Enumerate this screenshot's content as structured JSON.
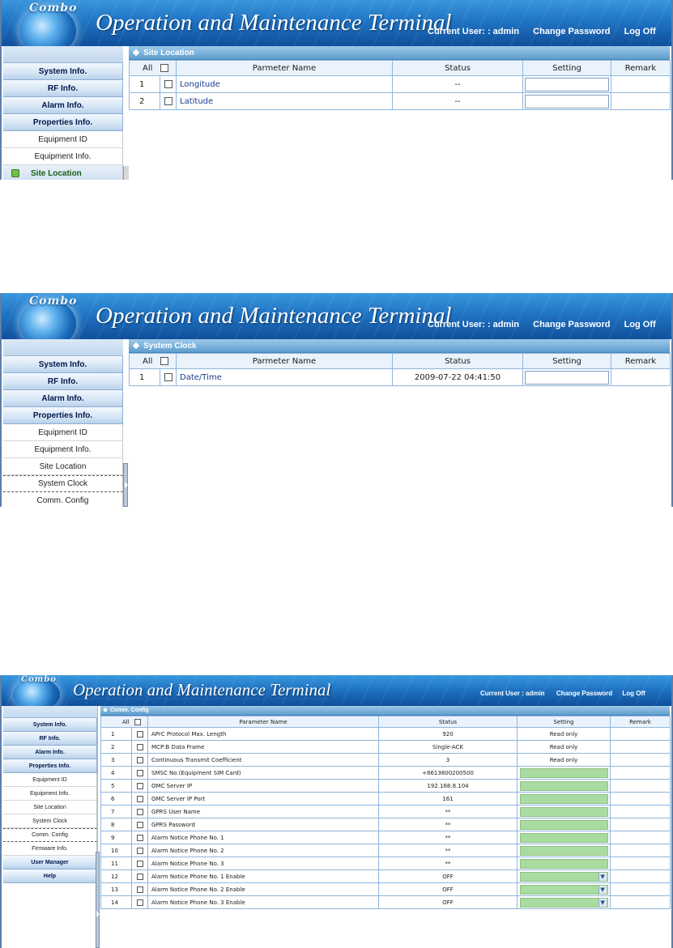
{
  "app": {
    "logo_text": "Combo",
    "title": "Operation and Maintenance Terminal",
    "user_label_top": "Current User: : admin",
    "user_label_bottom": "Current User : admin",
    "change_password": "Change Password",
    "log_off": "Log Off"
  },
  "sidebar": {
    "main": {
      "system": "System Info.",
      "rf": "RF Info.",
      "alarm": "Alarm Info.",
      "properties": "Properties Info.",
      "user_manager": "User Manager",
      "help": "Help"
    },
    "sub": {
      "equipment_id": "Equipment ID",
      "equipment_info": "Equipment Info.",
      "site_location": "Site Location",
      "system_clock": "System Clock",
      "comm_config": "Comm. Config",
      "firmware_info": "Firmware Info."
    }
  },
  "columns": {
    "all": "All",
    "name": "Parmeter Name",
    "name_alt": "Parameter Name",
    "status": "Status",
    "setting": "Setting",
    "remark": "Remark"
  },
  "panel1": {
    "section": "Site Location",
    "rows": [
      {
        "n": "1",
        "name": "Longitude",
        "status": "--"
      },
      {
        "n": "2",
        "name": "Latitude",
        "status": "--"
      }
    ]
  },
  "panel2": {
    "section": "System Clock",
    "rows": [
      {
        "n": "1",
        "name": "Date/Time",
        "status": "2009-07-22 04:41:50"
      }
    ]
  },
  "panel3": {
    "section": "Comm. Config",
    "rows": [
      {
        "n": "1",
        "name": "APrC Protocol Max. Length",
        "status": "920",
        "setting": "Read only"
      },
      {
        "n": "2",
        "name": "MCP:B Data Frame",
        "status": "Single-ACK",
        "setting": "Read only"
      },
      {
        "n": "3",
        "name": "Continuous Transmit Coefficient",
        "status": "3",
        "setting": "Read only"
      },
      {
        "n": "4",
        "name": "SMSC No.(Equipment SIM Card)",
        "status": "+8613800200500"
      },
      {
        "n": "5",
        "name": "OMC Server IP",
        "status": "192.168.8.104"
      },
      {
        "n": "6",
        "name": "OMC Server IP Port",
        "status": "161"
      },
      {
        "n": "7",
        "name": "GPRS User Name",
        "status": "**"
      },
      {
        "n": "8",
        "name": "GPRS Password",
        "status": "**"
      },
      {
        "n": "9",
        "name": "Alarm Notice Phone No. 1",
        "status": "**"
      },
      {
        "n": "10",
        "name": "Alarm Notice Phone No. 2",
        "status": "**"
      },
      {
        "n": "11",
        "name": "Alarm Notice Phone No. 3",
        "status": "**"
      },
      {
        "n": "12",
        "name": "Alarm Notice Phone No. 1 Enable",
        "status": "OFF"
      },
      {
        "n": "13",
        "name": "Alarm Notice Phone No. 2 Enable",
        "status": "OFF"
      },
      {
        "n": "14",
        "name": "Alarm Notice Phone No. 3 Enable",
        "status": "OFF"
      }
    ]
  },
  "colors": {
    "header_blue": "#2074c4",
    "nav_text": "#00174a",
    "param_text": "#1b3b8f",
    "setting_green": "#a9dca0",
    "active_item": "#1a5e10"
  }
}
